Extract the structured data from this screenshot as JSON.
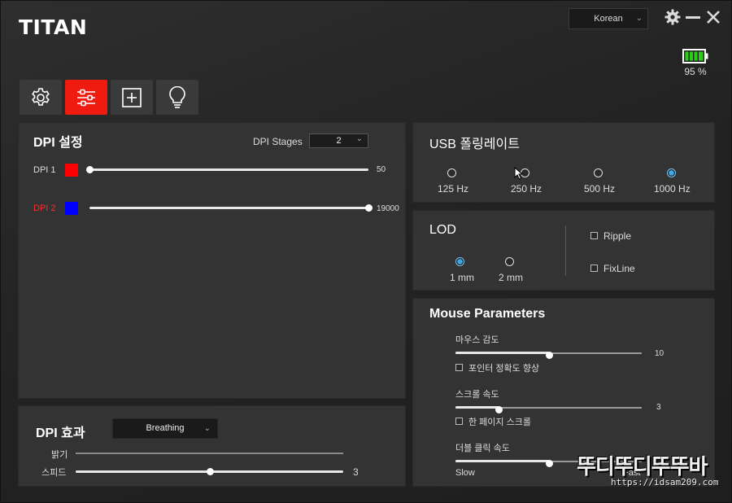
{
  "app": {
    "title": "TITAN"
  },
  "language": {
    "selected": "Korean"
  },
  "battery": {
    "percent_label": "95 %",
    "level": 0.95
  },
  "tabs": [
    {
      "name": "settings",
      "icon": "gear-icon",
      "active": false
    },
    {
      "name": "sliders",
      "icon": "sliders-icon",
      "active": true
    },
    {
      "name": "macro",
      "icon": "plus-square-icon",
      "active": false
    },
    {
      "name": "lighting",
      "icon": "bulb-icon",
      "active": false
    }
  ],
  "dpi": {
    "title": "DPI 설정",
    "stages_label": "DPI Stages",
    "stages_value": "2",
    "rows": [
      {
        "label": "DPI 1",
        "color": "#ff0000",
        "value": "50",
        "fraction": 0.0,
        "active": false
      },
      {
        "label": "DPI 2",
        "color": "#0000ff",
        "value": "19000",
        "fraction": 1.0,
        "active": true
      }
    ]
  },
  "effect": {
    "title": "DPI 효과",
    "mode": "Breathing",
    "brightness_label": "밝기",
    "speed_label": "스피드",
    "speed_value": "3",
    "speed_fraction": 0.5
  },
  "usb": {
    "title": "USB 폴링레이트",
    "options": [
      {
        "label": "125 Hz",
        "selected": false
      },
      {
        "label": "250 Hz",
        "selected": false
      },
      {
        "label": "500 Hz",
        "selected": false
      },
      {
        "label": "1000 Hz",
        "selected": true
      }
    ]
  },
  "lod": {
    "title": "LOD",
    "options": [
      {
        "label": "1 mm",
        "selected": true
      },
      {
        "label": "2 mm",
        "selected": false
      }
    ],
    "checks": [
      {
        "label": "Ripple",
        "checked": false
      },
      {
        "label": "FixLine",
        "checked": false
      }
    ]
  },
  "mouse": {
    "title": "Mouse Parameters",
    "sensitivity_label": "마우스 감도",
    "sensitivity_value": "10",
    "sensitivity_fraction": 0.5,
    "precision_label": "포인터 정확도 향상",
    "scroll_label": "스크롤 속도",
    "scroll_value": "3",
    "scroll_fraction": 0.23,
    "page_scroll_label": "한 페이지 스크롤",
    "dblclick_label": "더블 클릭 속도",
    "dblclick_fraction": 0.5,
    "slow_label": "Slow",
    "fast_label": "Fast"
  },
  "watermark": {
    "line1": "뚜디뚜디뚜뚜바",
    "line2": "https://idsam209.com"
  }
}
